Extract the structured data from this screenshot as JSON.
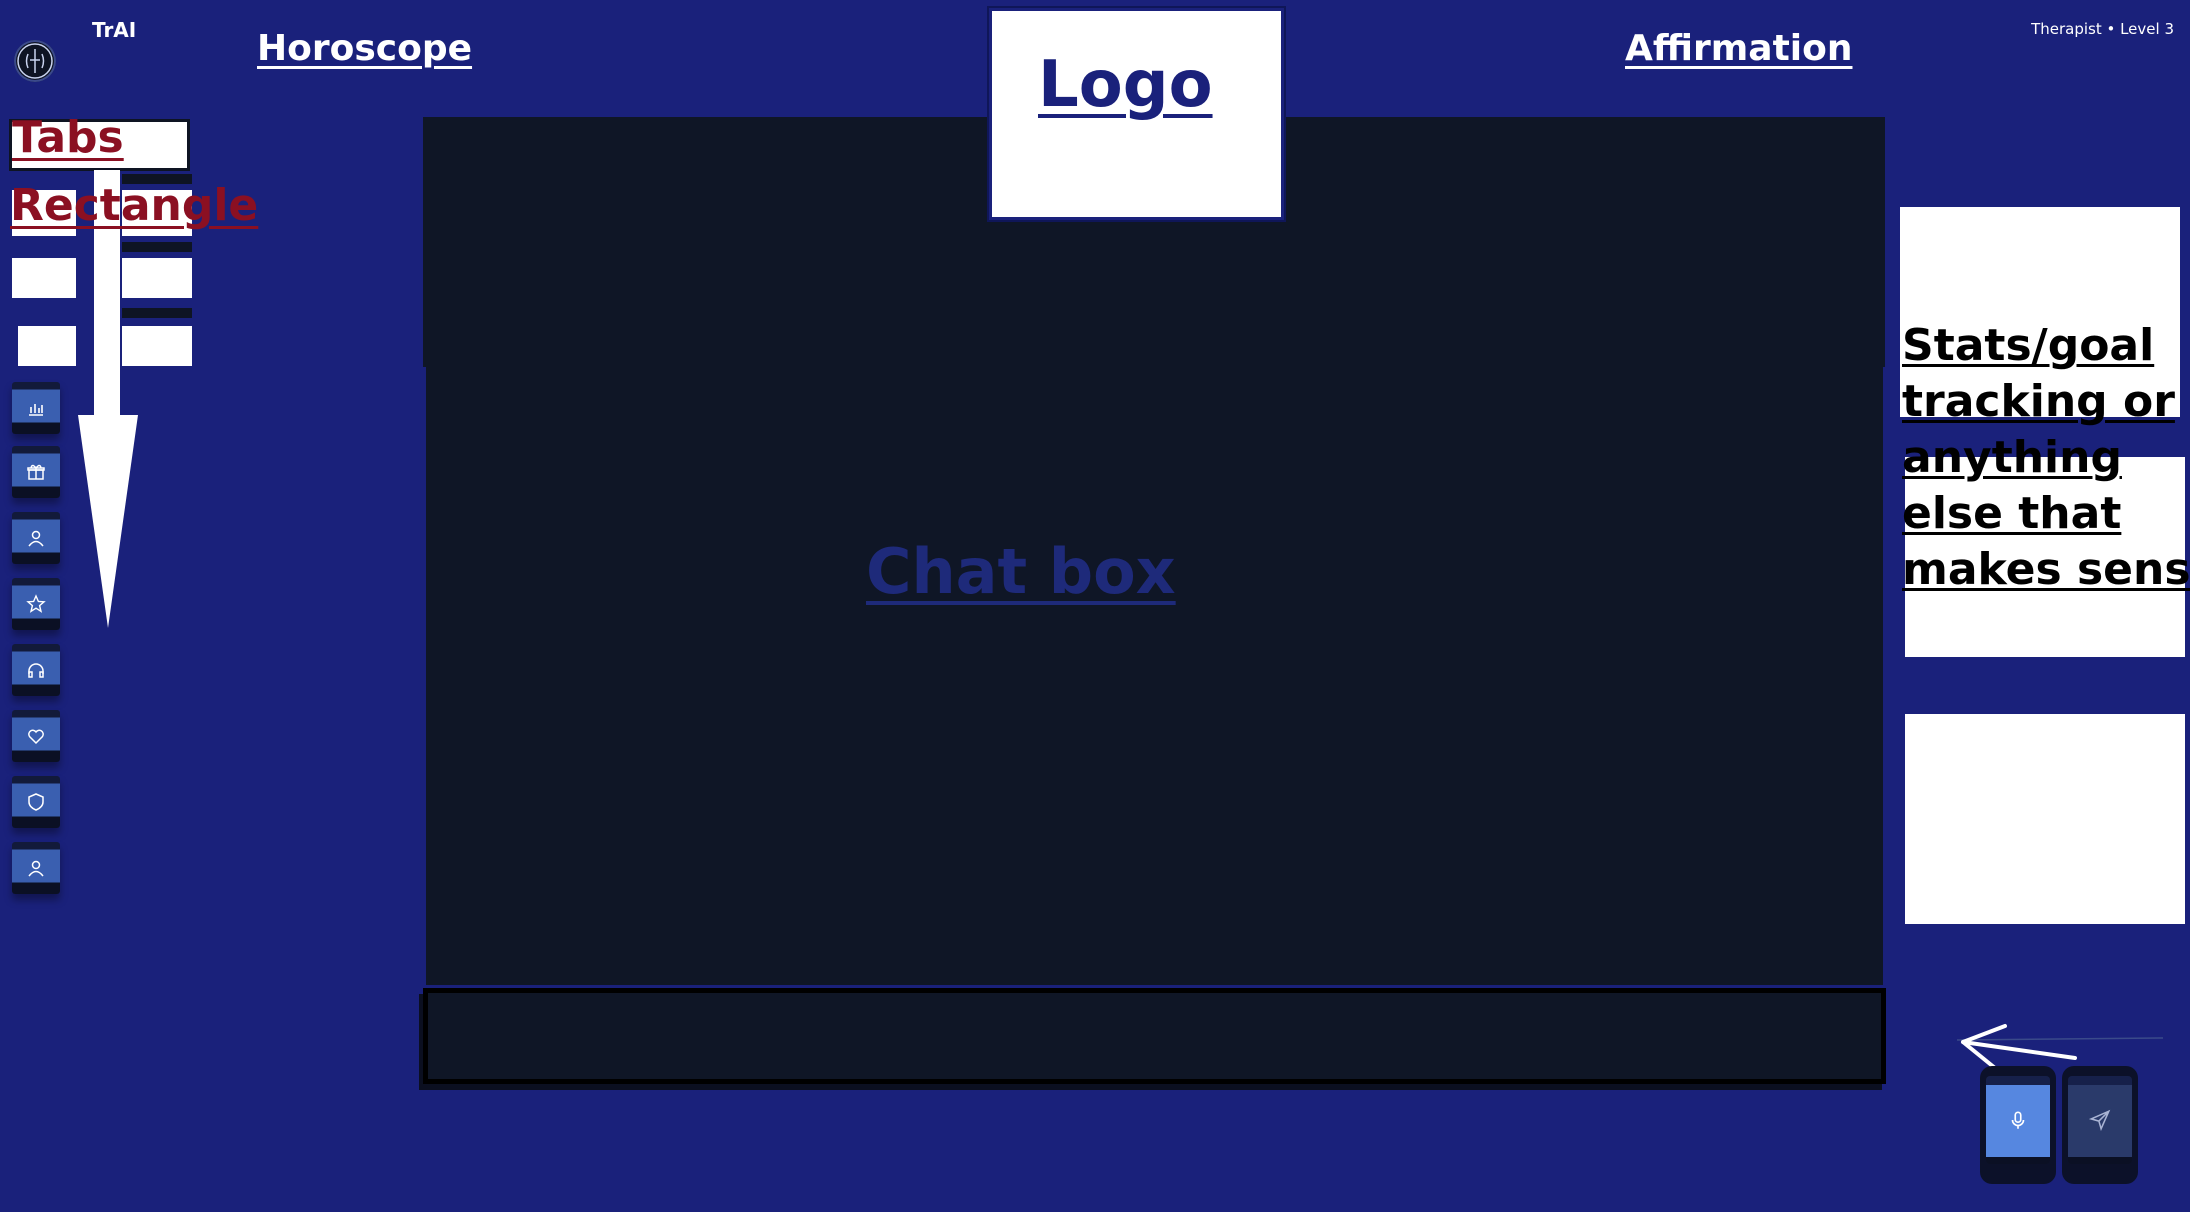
{
  "header": {
    "brand_title": "TrAI",
    "horoscope": "Horoscope",
    "affirmation": "Affirmation",
    "status": "Therapist • Level 3",
    "logo_label": "Logo"
  },
  "chat": {
    "label": "Chat box",
    "input_value": ""
  },
  "annotations": {
    "tabs": "Tabs",
    "rectangle": "Rectangle",
    "stats": "Stats/goal tracking or anything else that makes sense"
  },
  "sidebar": {
    "icons": [
      "bar-chart-icon",
      "gift-icon",
      "user-icon",
      "star-icon",
      "headphones-icon",
      "heart-icon",
      "shield-icon",
      "user-profile-icon"
    ]
  },
  "actions": {
    "mic_icon": "microphone-icon",
    "send_icon": "send-icon"
  },
  "colors": {
    "background": "#1a217b",
    "panel": "#0f1626",
    "annotation_red": "#8b1022",
    "button_blue": "#3a5fb0"
  }
}
